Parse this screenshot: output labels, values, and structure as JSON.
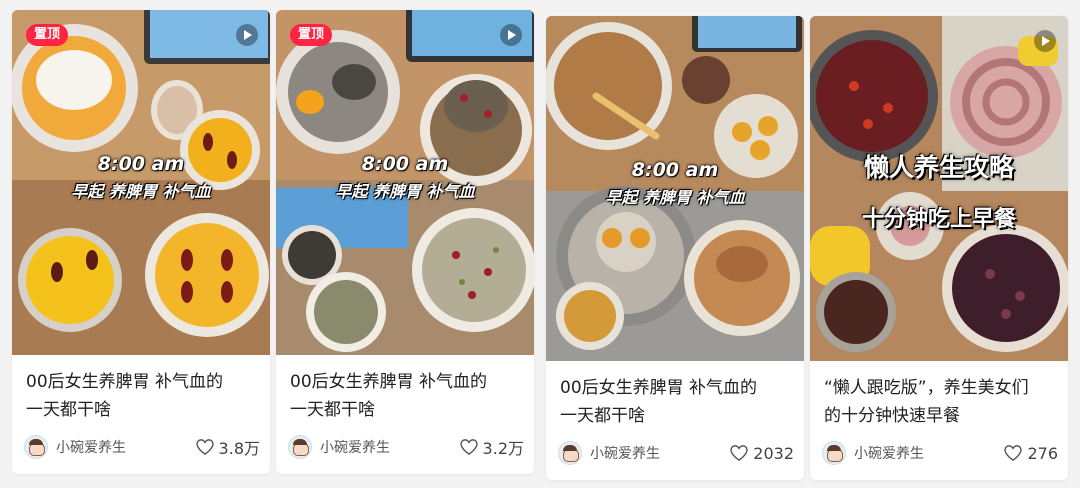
{
  "cards": [
    {
      "pinned": true,
      "pin_label": "置顶",
      "overlay_time": "8:00 am",
      "overlay_sub": "早起 养脾胃 补气血",
      "title_line1": "00后女生养脾胃 补气血的",
      "title_line2": "一天都干啥",
      "author": "小碗爱养生",
      "likes": "3.8万"
    },
    {
      "pinned": true,
      "pin_label": "置顶",
      "overlay_time": "8:00 am",
      "overlay_sub": "早起 养脾胃 补气血",
      "title_line1": "00后女生养脾胃 补气血的",
      "title_line2": "一天都干啥",
      "author": "小碗爱养生",
      "likes": "3.2万"
    },
    {
      "pinned": false,
      "overlay_time": "8:00 am",
      "overlay_sub": "早起 养脾胃 补气血",
      "title_line1": "00后女生养脾胃 补气血的",
      "title_line2": "一天都干啥",
      "author": "小碗爱养生",
      "likes": "2032"
    },
    {
      "pinned": false,
      "overlay_big": "懒人养生攻略",
      "overlay_mid": "十分钟吃上早餐",
      "title_line1": "“懒人跟吃版”，养生美女们",
      "title_line2": "的十分钟快速早餐",
      "author": "小碗爱养生",
      "likes": "276"
    }
  ],
  "colors": {
    "pin_red": "#ff2442",
    "card_bg": "#ffffff",
    "page_bg": "#f3f3f3"
  },
  "icons": [
    "play-video-icon",
    "heart-icon",
    "avatar"
  ]
}
